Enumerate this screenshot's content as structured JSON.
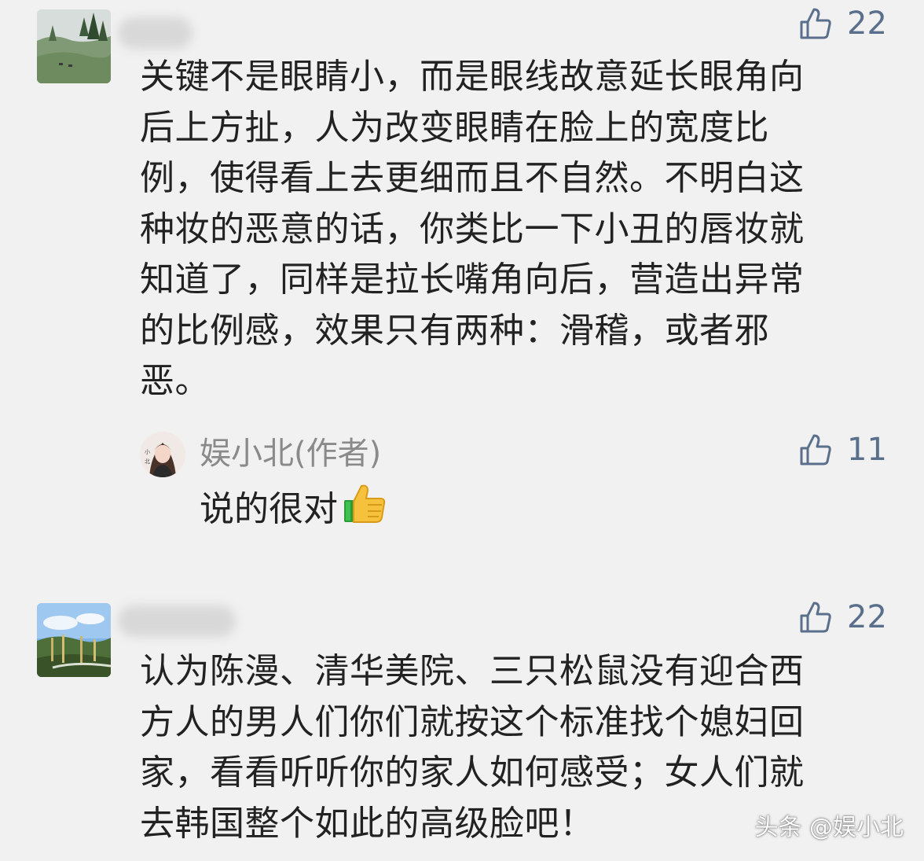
{
  "comments": [
    {
      "avatar_icon": "landscape-photo-avatar",
      "likes": "22",
      "text": "关键不是眼睛小，而是眼线故意延长眼角向后上方扯，人为改变眼睛在脸上的宽度比例，使得看上去更细而且不自然。不明白这种妆的恶意的话，你类比一下小丑的唇妆就知道了，同样是拉长嘴角向后，营造出异常的比例感，效果只有两种：滑稽，或者邪恶。",
      "lines": [
        "关键不是眼睛小，而是眼线故意延长眼角向",
        "后上方扯，人为改变眼睛在脸上的宽度比",
        "例，使得看上去更细而且不自然。不明白这",
        "种妆的恶意的话，你类比一下小丑的唇妆就",
        "知道了，同样是拉长嘴角向后，营造出异常",
        "的比例感，效果只有两种：滑稽，或者邪",
        "恶。"
      ],
      "reply": {
        "author": "娱小北(作者)",
        "text": "说的很对",
        "emoji": "thumbs-up-emoji",
        "likes": "11"
      }
    },
    {
      "avatar_icon": "landscape-photo-avatar",
      "likes": "22",
      "lines": [
        "认为陈漫、清华美院、三只松鼠没有迎合西",
        "方人的男人们你们就按这个标准找个媳妇回",
        "家，看看听听你的家人如何感受；女人们就",
        "去韩国整个如此的高级脸吧！"
      ]
    }
  ],
  "watermark": "头条 @娱小北",
  "colors": {
    "background": "#f1f1f1",
    "text": "#222222",
    "like": "#5a6f8c",
    "author_name": "#8a8a8a"
  }
}
